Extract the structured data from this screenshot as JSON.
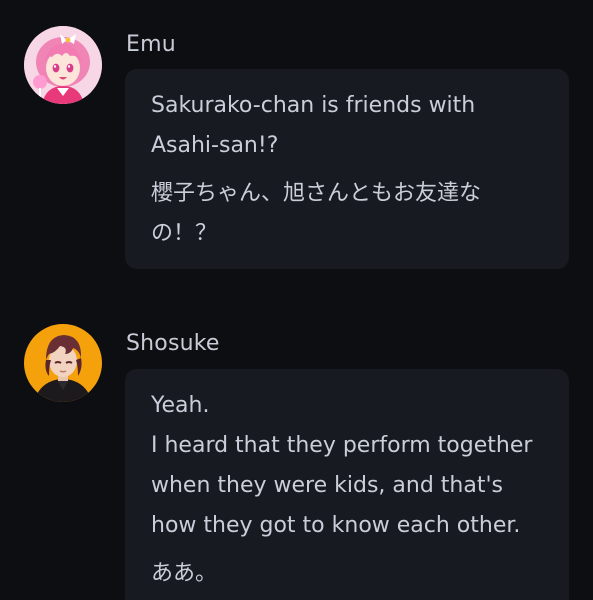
{
  "messages": [
    {
      "sender": "Emu",
      "avatar": "emu-avatar-pink-hair",
      "text_en": "Sakurako-chan is friends with Asahi-san!?",
      "text_ja": "櫻子ちゃん、旭さんともお友達なの！？"
    },
    {
      "sender": "Shosuke",
      "avatar": "shosuke-avatar-orange-background",
      "text_en": "Yeah.\nI heard that they perform together when they were kids, and that's how they got to know each other.",
      "text_ja": "ああ。"
    }
  ],
  "colors": {
    "background": "#0d0e12",
    "bubble": "#171a21",
    "text": "#c9ced8",
    "emu_accent": "#f06aa8",
    "shosuke_accent": "#f5a10c"
  }
}
